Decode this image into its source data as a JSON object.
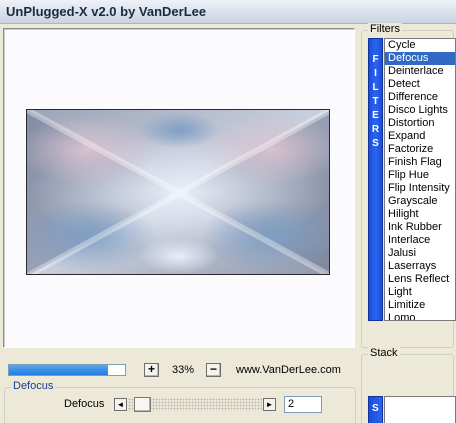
{
  "window": {
    "title": "UnPlugged-X v2.0 by VanDerLee"
  },
  "zoom": {
    "in_label": "+",
    "out_label": "−",
    "value": "33%"
  },
  "url": "www.VanDerLee.com",
  "progress": {
    "fraction": 0.85,
    "color": "#2b87e6"
  },
  "filters": {
    "title": "Filters",
    "strip_letters": [
      "F",
      "I",
      "L",
      "T",
      "E",
      "R",
      "S"
    ],
    "items": [
      "Cycle",
      "Defocus",
      "Deinterlace",
      "Detect",
      "Difference",
      "Disco Lights",
      "Distortion",
      "Expand",
      "Factorize",
      "Finish Flag",
      "Flip Hue",
      "Flip Intensity",
      "Grayscale",
      "Hilight",
      "Ink Rubber",
      "Interlace",
      "Jalusi",
      "Laserrays",
      "Lens Reflect",
      "Light",
      "Limitize",
      "Lomo"
    ],
    "selected": "Defocus"
  },
  "parameter": {
    "group_title": "Defocus",
    "label": "Defocus",
    "value": "2",
    "left_arrow": "◄",
    "right_arrow": "►"
  },
  "stack": {
    "title": "Stack",
    "strip_letter": "S"
  },
  "colors": {
    "selection": "#316ac5",
    "strip": "#2a64ef",
    "group_title": "#1a3d8f"
  }
}
